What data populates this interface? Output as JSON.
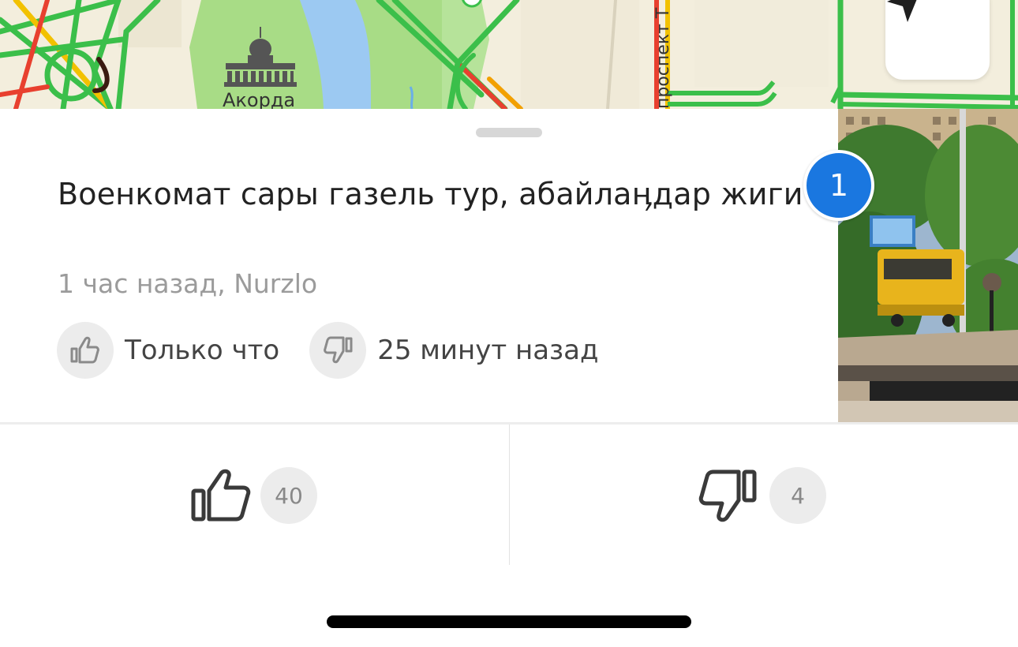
{
  "map": {
    "place_label": "Акорда",
    "street_label": "проспект Т"
  },
  "event": {
    "title": "Военкомат сары газель тур, абайлаӊдар жиги",
    "meta": "1 час назад, Nurzlo",
    "last_like": "Только что",
    "last_dislike": "25 минут назад",
    "photo_count": "1"
  },
  "votes": {
    "likes": "40",
    "dislikes": "4"
  },
  "icons": {
    "locate": "navigation-arrow-icon",
    "like": "thumbs-up-icon",
    "dislike": "thumbs-down-icon",
    "landmark": "government-building-icon"
  },
  "colors": {
    "badge": "#1a77e0",
    "traffic_green": "#3bbf4a",
    "traffic_yellow": "#f2c100",
    "traffic_red": "#e8402f",
    "park": "#a6dc84",
    "water": "#9cc9f2"
  }
}
